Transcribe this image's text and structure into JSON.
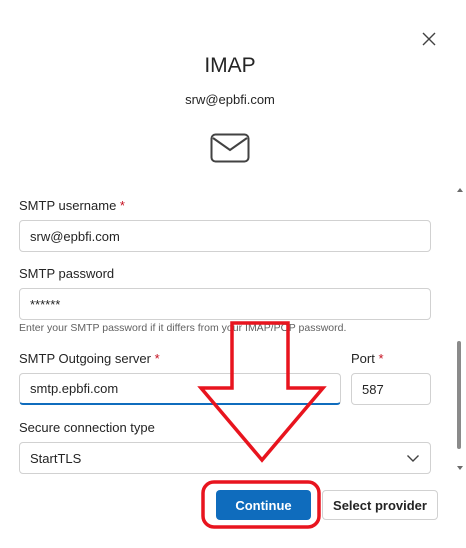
{
  "dialog": {
    "title": "IMAP",
    "account_email": "srw@epbfi.com"
  },
  "icons": {
    "close": "close-icon",
    "mail": "mail-icon",
    "chevron": "chevron-down-icon"
  },
  "form": {
    "smtp_username": {
      "label": "SMTP username",
      "required_mark": "*",
      "value": "srw@epbfi.com"
    },
    "smtp_password": {
      "label": "SMTP password",
      "value": "******",
      "hint": "Enter your SMTP password if it differs from your IMAP/POP password."
    },
    "smtp_server": {
      "label": "SMTP Outgoing server",
      "required_mark": "*",
      "value": "smtp.epbfi.com"
    },
    "port": {
      "label": "Port",
      "required_mark": "*",
      "value": "587"
    },
    "secure_connection": {
      "label": "Secure connection type",
      "selected": "StartTLS"
    }
  },
  "buttons": {
    "continue": "Continue",
    "select_provider": "Select provider"
  },
  "colors": {
    "accent": "#0f6cbd",
    "required": "#c50f1f",
    "annotation": "#e8141e"
  }
}
